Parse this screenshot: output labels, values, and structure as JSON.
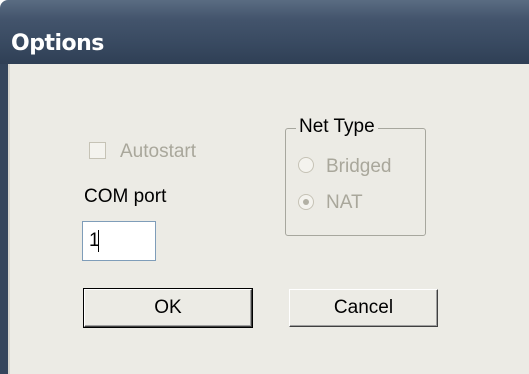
{
  "window": {
    "title": "Options"
  },
  "autostart": {
    "label": "Autostart",
    "checked": false,
    "enabled": false
  },
  "com_port": {
    "label": "COM port",
    "value": "1"
  },
  "net_type": {
    "label": "Net Type",
    "options": [
      {
        "label": "Bridged",
        "selected": false,
        "enabled": false
      },
      {
        "label": "NAT",
        "selected": true,
        "enabled": false
      }
    ]
  },
  "buttons": {
    "ok_label": "OK",
    "cancel_label": "Cancel"
  },
  "colors": {
    "titlebar": "#384960",
    "client_background": "#ecebe5",
    "disabled_text": "#a9a79b"
  }
}
